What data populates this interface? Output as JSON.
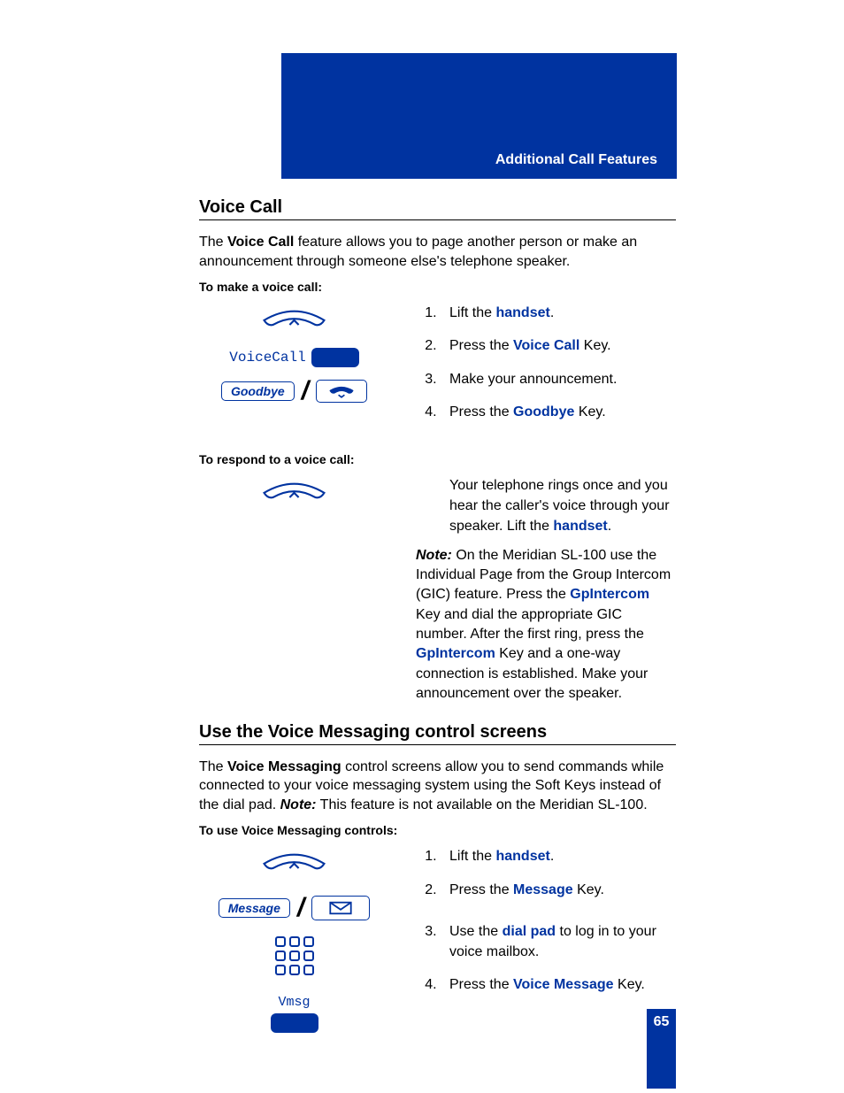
{
  "header": {
    "section": "Additional Call Features"
  },
  "page_number": "65",
  "voice_call": {
    "title": "Voice Call",
    "intro_pre": "The ",
    "intro_bold": "Voice Call",
    "intro_post": " feature allows you to page another person or make an announcement through someone else's telephone speaker.",
    "make_heading": "To make a voice call:",
    "icon_voicecall_label": "VoiceCall",
    "goodbye_key_label": "Goodbye",
    "steps": {
      "s1_pre": "Lift the ",
      "s1_kw": "handset",
      "s1_post": ".",
      "s2_pre": "Press the ",
      "s2_kw": "Voice Call",
      "s2_post": " Key.",
      "s3": "Make your announcement.",
      "s4_pre": "Press the ",
      "s4_kw": "Goodbye",
      "s4_post": " Key."
    },
    "respond_heading": "To respond to a voice call:",
    "respond_text_pre": "Your telephone rings once and you hear the caller's voice through your speaker. Lift the ",
    "respond_kw": "handset",
    "respond_text_post": ".",
    "note_label": "Note:",
    "note_a": " On the Meridian SL-100 use the Individual Page from the Group Intercom (GIC) feature. Press the ",
    "note_kw1": "GpIntercom",
    "note_b": " Key and dial the appropriate GIC number. After the first ring, press the ",
    "note_kw2": "GpIntercom",
    "note_c": " Key and a one-way connection is established. Make your announcement over the speaker."
  },
  "voice_messaging": {
    "title": "Use the Voice Messaging control screens",
    "intro_pre": "The ",
    "intro_bold": "Voice Messaging",
    "intro_mid": " control screens allow you to send commands while connected to your voice messaging system using the Soft Keys instead of the dial pad. ",
    "intro_note_label": "Note:",
    "intro_note": " This feature is not available on the Meridian SL-100.",
    "use_heading": "To use Voice Messaging controls:",
    "message_key_label": "Message",
    "vmsg_label": "Vmsg",
    "steps": {
      "s1_pre": "Lift the ",
      "s1_kw": "handset",
      "s1_post": ".",
      "s2_pre": "Press the ",
      "s2_kw": "Message",
      "s2_post": " Key.",
      "s3_pre": "Use the ",
      "s3_kw": "dial pad",
      "s3_post": " to log in to your voice mailbox.",
      "s4_pre": "Press the ",
      "s4_kw": "Voice Message",
      "s4_post": " Key."
    }
  }
}
